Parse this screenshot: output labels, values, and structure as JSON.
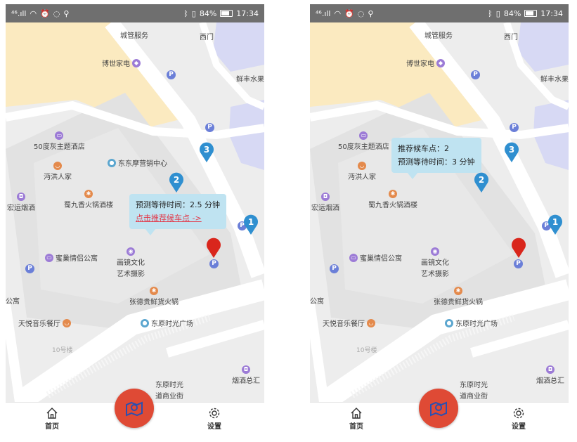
{
  "status_bar": {
    "signal": "⁴⁶.ıll",
    "battery": "84%",
    "time": "17:34"
  },
  "map": {
    "pois": {
      "chengguan": "城管服务",
      "ximen": "西门",
      "boshi": "博世家电",
      "xianfeng": "鲜丰水果",
      "wushidu": "50度灰主题酒店",
      "dongdongmo": "东东摩营销中心",
      "wuhong": "沔洪人家",
      "hongyun": "宏运烟酒",
      "shujiuxiang": "蜀九香火锅酒楼",
      "michao": "蜜巢情侣公寓",
      "huajing_1": "画镜文化",
      "huajing_2": "艺术摄影",
      "zhangdegui": "张德贵鲜货火锅",
      "gongyu": "公寓",
      "tianyue": "天悦音乐餐厅",
      "dongyuan_sg": "东原时光广场",
      "shihao": "10号楼",
      "dongyuan_1": "东原时光",
      "dongyuan_2": "道商业街",
      "yanjiu": "烟酒总汇"
    },
    "pins": [
      "1",
      "2",
      "3"
    ],
    "parking_label": "P"
  },
  "left": {
    "bubble": {
      "wait_time": "预测等待时间：2.5 分钟",
      "link": "点击推荐候车点 ->"
    }
  },
  "right": {
    "bubble": {
      "rec_point": "推荐候车点：2",
      "wait_time": "预测等待时间：3 分钟"
    }
  },
  "nav": {
    "home": "首页",
    "settings": "设置"
  },
  "colors": {
    "accent": "#df4a35",
    "pin_blue": "#2f8fd0",
    "pin_red": "#d9261c",
    "bubble": "#bfe3f1"
  }
}
